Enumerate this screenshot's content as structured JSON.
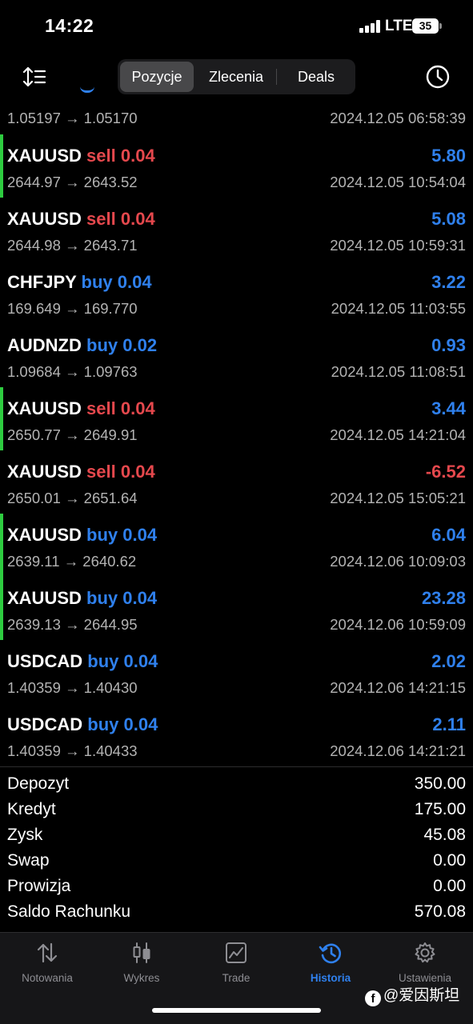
{
  "status_bar": {
    "time": "14:22",
    "network": "LTE",
    "battery": "35"
  },
  "segments": [
    {
      "label": "Pozycje",
      "active": true
    },
    {
      "label": "Zlecenia",
      "active": false
    },
    {
      "label": "Deals",
      "active": false
    }
  ],
  "partial_row": {
    "prices": "1.05197 → 1.05170",
    "date": "2024.12.05 06:58:39"
  },
  "deals": [
    {
      "symbol": "XAUUSD",
      "direction": "sell",
      "volume": "0.04",
      "profit": "5.80",
      "prices": "2644.97 → 2643.52",
      "date": "2024.12.05 10:54:04",
      "marker": true
    },
    {
      "symbol": "XAUUSD",
      "direction": "sell",
      "volume": "0.04",
      "profit": "5.08",
      "prices": "2644.98 → 2643.71",
      "date": "2024.12.05 10:59:31",
      "marker": false
    },
    {
      "symbol": "CHFJPY",
      "direction": "buy",
      "volume": "0.04",
      "profit": "3.22",
      "prices": "169.649 → 169.770",
      "date": "2024.12.05 11:03:55",
      "marker": false
    },
    {
      "symbol": "AUDNZD",
      "direction": "buy",
      "volume": "0.02",
      "profit": "0.93",
      "prices": "1.09684 → 1.09763",
      "date": "2024.12.05 11:08:51",
      "marker": false
    },
    {
      "symbol": "XAUUSD",
      "direction": "sell",
      "volume": "0.04",
      "profit": "3.44",
      "prices": "2650.77 → 2649.91",
      "date": "2024.12.05 14:21:04",
      "marker": true
    },
    {
      "symbol": "XAUUSD",
      "direction": "sell",
      "volume": "0.04",
      "profit": "-6.52",
      "prices": "2650.01 → 2651.64",
      "date": "2024.12.05 15:05:21",
      "marker": false
    },
    {
      "symbol": "XAUUSD",
      "direction": "buy",
      "volume": "0.04",
      "profit": "6.04",
      "prices": "2639.11 → 2640.62",
      "date": "2024.12.06 10:09:03",
      "marker": true
    },
    {
      "symbol": "XAUUSD",
      "direction": "buy",
      "volume": "0.04",
      "profit": "23.28",
      "prices": "2639.13 → 2644.95",
      "date": "2024.12.06 10:59:09",
      "marker": true
    },
    {
      "symbol": "USDCAD",
      "direction": "buy",
      "volume": "0.04",
      "profit": "2.02",
      "prices": "1.40359 → 1.40430",
      "date": "2024.12.06 14:21:15",
      "marker": false
    },
    {
      "symbol": "USDCAD",
      "direction": "buy",
      "volume": "0.04",
      "profit": "2.11",
      "prices": "1.40359 → 1.40433",
      "date": "2024.12.06 14:21:21",
      "marker": false
    }
  ],
  "summary": [
    {
      "label": "Depozyt",
      "value": "350.00"
    },
    {
      "label": "Kredyt",
      "value": "175.00"
    },
    {
      "label": "Zysk",
      "value": "45.08"
    },
    {
      "label": "Swap",
      "value": "0.00"
    },
    {
      "label": "Prowizja",
      "value": "0.00"
    },
    {
      "label": "Saldo Rachunku",
      "value": "570.08"
    }
  ],
  "tabs": [
    {
      "label": "Notowania",
      "icon": "arrows-updown-icon",
      "active": false
    },
    {
      "label": "Wykres",
      "icon": "candlestick-icon",
      "active": false
    },
    {
      "label": "Trade",
      "icon": "trade-chart-icon",
      "active": false
    },
    {
      "label": "Historia",
      "icon": "history-icon",
      "active": true
    },
    {
      "label": "Ustawienia",
      "icon": "gear-icon",
      "active": false
    }
  ],
  "colors": {
    "buy": "#2f80ed",
    "sell": "#e5484d",
    "profit_positive": "#2f80ed",
    "profit_negative": "#e5484d",
    "marker": "#2ecc40",
    "accent": "#2f80ed"
  },
  "watermark": {
    "text": "@爱因斯坦"
  }
}
